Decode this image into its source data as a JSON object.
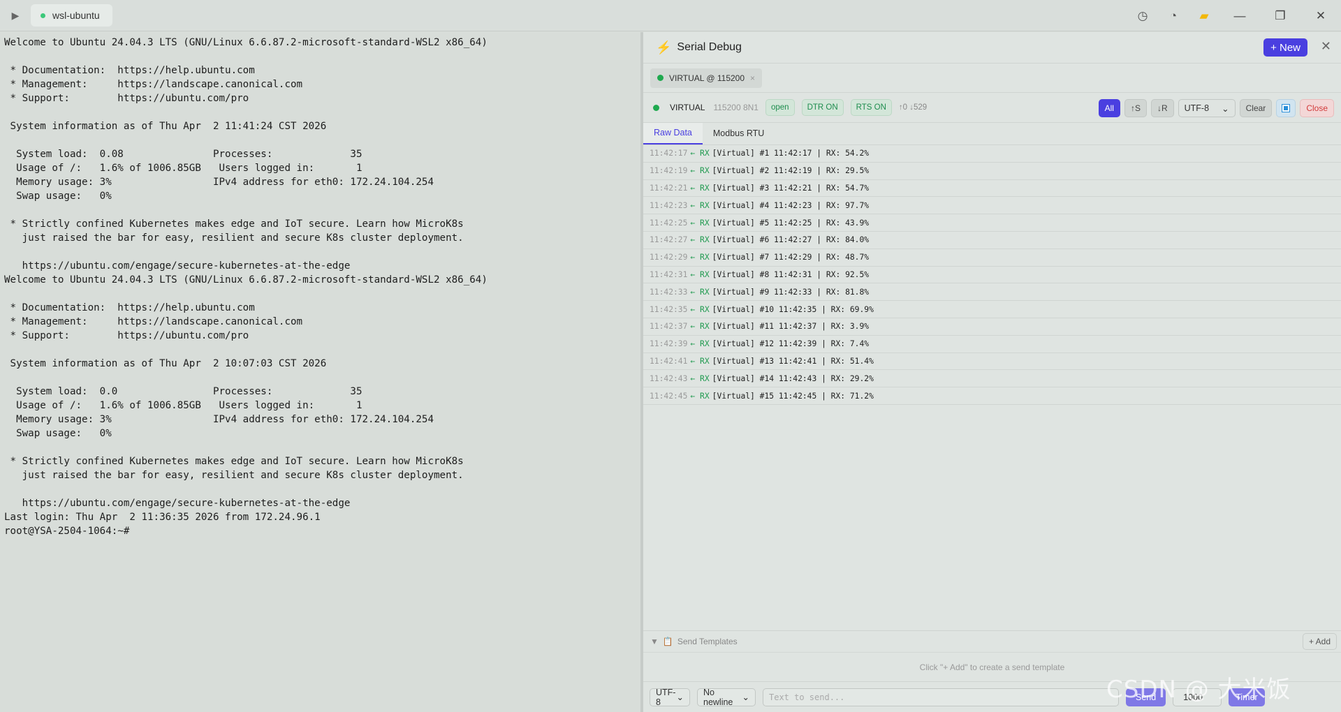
{
  "titlebar": {
    "tab_label": "wsl-ubuntu",
    "icons": [
      "play-icon",
      "history-icon",
      "clock-icon",
      "folder-icon",
      "minimize-icon",
      "maximize-icon",
      "close-icon"
    ]
  },
  "terminal": {
    "lines": [
      "Welcome to Ubuntu 24.04.3 LTS (GNU/Linux 6.6.87.2-microsoft-standard-WSL2 x86_64)",
      "",
      " * Documentation:  https://help.ubuntu.com",
      " * Management:     https://landscape.canonical.com",
      " * Support:        https://ubuntu.com/pro",
      "",
      " System information as of Thu Apr  2 11:41:24 CST 2026",
      "",
      "  System load:  0.08               Processes:             35",
      "  Usage of /:   1.6% of 1006.85GB   Users logged in:       1",
      "  Memory usage: 3%                 IPv4 address for eth0: 172.24.104.254",
      "  Swap usage:   0%",
      "",
      " * Strictly confined Kubernetes makes edge and IoT secure. Learn how MicroK8s",
      "   just raised the bar for easy, resilient and secure K8s cluster deployment.",
      "",
      "   https://ubuntu.com/engage/secure-kubernetes-at-the-edge",
      "Welcome to Ubuntu 24.04.3 LTS (GNU/Linux 6.6.87.2-microsoft-standard-WSL2 x86_64)",
      "",
      " * Documentation:  https://help.ubuntu.com",
      " * Management:     https://landscape.canonical.com",
      " * Support:        https://ubuntu.com/pro",
      "",
      " System information as of Thu Apr  2 10:07:03 CST 2026",
      "",
      "  System load:  0.0                Processes:             35",
      "  Usage of /:   1.6% of 1006.85GB   Users logged in:       1",
      "  Memory usage: 3%                 IPv4 address for eth0: 172.24.104.254",
      "  Swap usage:   0%",
      "",
      " * Strictly confined Kubernetes makes edge and IoT secure. Learn how MicroK8s",
      "   just raised the bar for easy, resilient and secure K8s cluster deployment.",
      "",
      "   https://ubuntu.com/engage/secure-kubernetes-at-the-edge",
      "Last login: Thu Apr  2 11:36:35 2026 from 172.24.96.1",
      "root@YSA-2504-1064:~#"
    ]
  },
  "serial": {
    "title": "Serial Debug",
    "new_label": "+ New",
    "close_symbol": "✕",
    "conn_tab": {
      "label": "VIRTUAL @ 115200",
      "close": "×"
    },
    "status": {
      "name": "VIRTUAL",
      "config": "115200 8N1",
      "pills": [
        "open",
        "DTR ON",
        "RTS ON"
      ],
      "counts": "↑0 ↓529"
    },
    "controls": {
      "all": "All",
      "send_filter": "↑S",
      "recv_filter": "↓R",
      "encoding": "UTF-8",
      "clear": "Clear",
      "close": "Close"
    },
    "tabs": [
      "Raw Data",
      "Modbus RTU"
    ],
    "active_tab": "Raw Data",
    "log": [
      {
        "ts": "11:42:17",
        "dir": "← RX",
        "msg": "[Virtual] #1 11:42:17 | RX: 54.2%"
      },
      {
        "ts": "11:42:19",
        "dir": "← RX",
        "msg": "[Virtual] #2 11:42:19 | RX: 29.5%"
      },
      {
        "ts": "11:42:21",
        "dir": "← RX",
        "msg": "[Virtual] #3 11:42:21 | RX: 54.7%"
      },
      {
        "ts": "11:42:23",
        "dir": "← RX",
        "msg": "[Virtual] #4 11:42:23 | RX: 97.7%"
      },
      {
        "ts": "11:42:25",
        "dir": "← RX",
        "msg": "[Virtual] #5 11:42:25 | RX: 43.9%"
      },
      {
        "ts": "11:42:27",
        "dir": "← RX",
        "msg": "[Virtual] #6 11:42:27 | RX: 84.0%"
      },
      {
        "ts": "11:42:29",
        "dir": "← RX",
        "msg": "[Virtual] #7 11:42:29 | RX: 48.7%"
      },
      {
        "ts": "11:42:31",
        "dir": "← RX",
        "msg": "[Virtual] #8 11:42:31 | RX: 92.5%"
      },
      {
        "ts": "11:42:33",
        "dir": "← RX",
        "msg": "[Virtual] #9 11:42:33 | RX: 81.8%"
      },
      {
        "ts": "11:42:35",
        "dir": "← RX",
        "msg": "[Virtual] #10 11:42:35 | RX: 69.9%"
      },
      {
        "ts": "11:42:37",
        "dir": "← RX",
        "msg": "[Virtual] #11 11:42:37 | RX: 3.9%"
      },
      {
        "ts": "11:42:39",
        "dir": "← RX",
        "msg": "[Virtual] #12 11:42:39 | RX: 7.4%"
      },
      {
        "ts": "11:42:41",
        "dir": "← RX",
        "msg": "[Virtual] #13 11:42:41 | RX: 51.4%"
      },
      {
        "ts": "11:42:43",
        "dir": "← RX",
        "msg": "[Virtual] #14 11:42:43 | RX: 29.2%"
      },
      {
        "ts": "11:42:45",
        "dir": "← RX",
        "msg": "[Virtual] #15 11:42:45 | RX: 71.2%"
      }
    ],
    "templates": {
      "label": "Send Templates",
      "add": "+ Add",
      "hint": "Click \"+ Add\" to create a send template"
    },
    "send": {
      "encoding": "UTF-8",
      "newline": "No newline",
      "placeholder": "Text to send...",
      "send_label": "Send",
      "interval": "1000",
      "timer_label": "Timer"
    }
  },
  "watermark": "CSDN @ 大米饭",
  "colors": {
    "accent": "#4a3fe0",
    "rx_green": "#1f9a4f",
    "close_red": "#d23b3b",
    "bolt_orange": "#f08a24"
  }
}
